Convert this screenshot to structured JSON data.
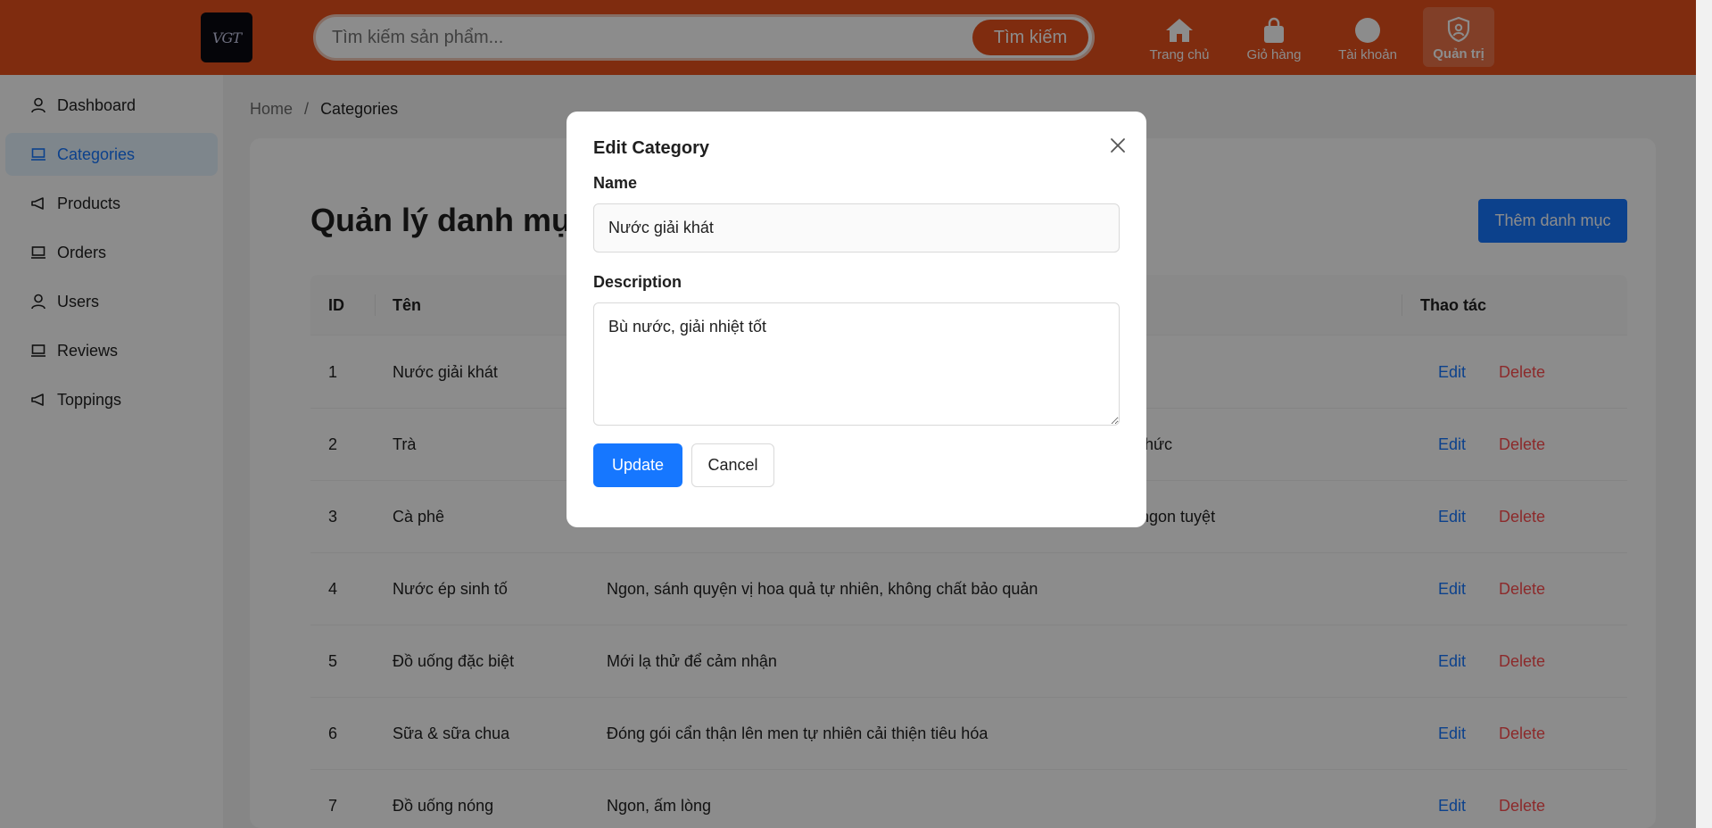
{
  "header": {
    "logo_text": "VGT",
    "search": {
      "placeholder": "Tìm kiếm sản phẩm...",
      "button_label": "Tìm kiếm"
    },
    "nav": [
      {
        "label": "Trang chủ",
        "icon": "home-icon"
      },
      {
        "label": "Giỏ hàng",
        "icon": "bag-icon"
      },
      {
        "label": "Tài khoản",
        "icon": "user-circle-icon"
      },
      {
        "label": "Quản trị",
        "icon": "shield-icon",
        "active": true
      }
    ]
  },
  "sidebar": {
    "items": [
      {
        "label": "Dashboard",
        "icon": "user-icon"
      },
      {
        "label": "Categories",
        "icon": "laptop-icon",
        "active": true
      },
      {
        "label": "Products",
        "icon": "megaphone-icon"
      },
      {
        "label": "Orders",
        "icon": "laptop-icon"
      },
      {
        "label": "Users",
        "icon": "user-icon"
      },
      {
        "label": "Reviews",
        "icon": "laptop-icon"
      },
      {
        "label": "Toppings",
        "icon": "megaphone-icon"
      }
    ]
  },
  "breadcrumb": {
    "home": "Home",
    "separator": "/",
    "current": "Categories"
  },
  "page": {
    "title": "Quản lý danh mục",
    "add_button": "Thêm danh mục"
  },
  "table": {
    "columns": [
      "ID",
      "Tên",
      "",
      "Thao tác"
    ],
    "edit_label": "Edit",
    "delete_label": "Delete",
    "rows": [
      {
        "id": "1",
        "name": "Nước giải khát",
        "description": ""
      },
      {
        "id": "2",
        "name": "Trà",
        "description": "thức"
      },
      {
        "id": "3",
        "name": "Cà phê",
        "description": "ngon tuyệt"
      },
      {
        "id": "4",
        "name": "Nước ép sinh tố",
        "description": "Ngon, sánh quyện vị hoa quả tự nhiên, không chất bảo quản"
      },
      {
        "id": "5",
        "name": "Đồ uống đặc biệt",
        "description": "Mới lạ thử để cảm nhận"
      },
      {
        "id": "6",
        "name": "Sữa & sữa chua",
        "description": "Đóng gói cẩn thận lên men tự nhiên cải thiện tiêu hóa"
      },
      {
        "id": "7",
        "name": "Đồ uống nóng",
        "description": "Ngon, ấm lòng"
      }
    ]
  },
  "modal": {
    "title": "Edit Category",
    "name_label": "Name",
    "name_value": "Nước giải khát",
    "description_label": "Description",
    "description_value": "Bù nước, giải nhiệt tốt",
    "update_label": "Update",
    "cancel_label": "Cancel"
  },
  "colors": {
    "brand": "#e8501c",
    "primary": "#1677ff",
    "danger": "#ff4d4f"
  }
}
